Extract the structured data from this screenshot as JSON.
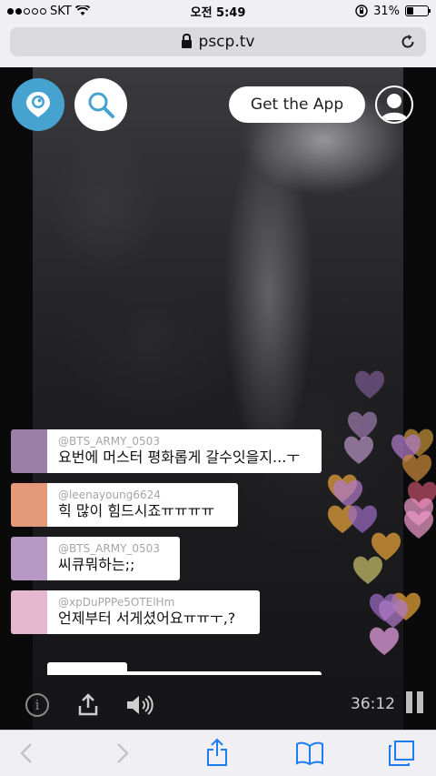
{
  "status_bar": {
    "carrier": "SKT",
    "time": "오전 5:49",
    "battery": "31%",
    "battery_level": 0.31
  },
  "browser": {
    "url": "pscp.tv"
  },
  "header": {
    "get_app_label": "Get the App"
  },
  "comments": [
    {
      "user": "@BTS_ARMY_0503",
      "text": "요번에 머스터 평화롭게 갈수잇을지...ㅜ",
      "avatar_color": "#9c7fa6"
    },
    {
      "user": "@leenayoung6624",
      "text": "힉 많이 힘드시죠ㅠㅠㅠㅠ",
      "avatar_color": "#e49a7a"
    },
    {
      "user": "@BTS_ARMY_0503",
      "text": "씨큐뭐하는;;",
      "avatar_color": "#b799c4"
    },
    {
      "user": "@xpDuPPPe5OTElHm",
      "text": "언제부터 서게셨어요ㅠㅠㅜ,?",
      "avatar_color": "#e6b8cf"
    }
  ],
  "player": {
    "timer": "36:12"
  },
  "colors": {
    "periscope_blue": "#46a3d0",
    "heart_purple": "#b07ac9",
    "heart_orange": "#e8a43a",
    "heart_pink": "#ee9ac9"
  },
  "icons": {
    "periscope": "periscope-logo-icon",
    "search": "search-icon",
    "profile": "profile-icon",
    "info": "info-icon",
    "share": "share-icon",
    "volume": "volume-icon",
    "pause": "pause-icon",
    "back": "back-icon",
    "forward": "forward-icon",
    "safari_share": "share-icon",
    "bookmarks": "bookmarks-icon",
    "tabs": "tabs-icon"
  }
}
